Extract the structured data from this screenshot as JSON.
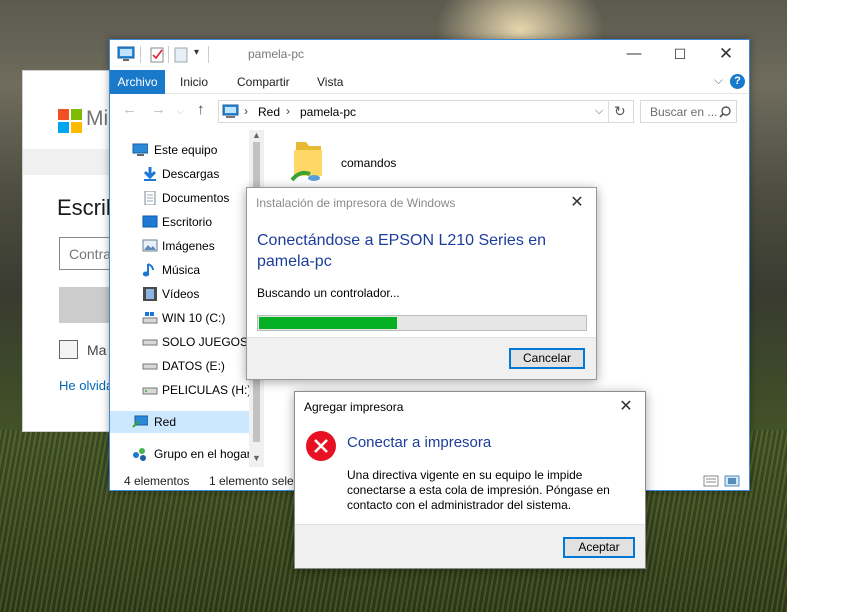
{
  "colors": {
    "accent": "#1979ca",
    "progress": "#06b025",
    "error": "#e81123",
    "selection": "#cce8ff"
  },
  "login": {
    "brand": "Mi",
    "heading": "Escrib",
    "password_placeholder": "Contra",
    "remember_label": "Ma",
    "forgot_link": "He olvida"
  },
  "explorer": {
    "title": "pamela-pc",
    "ribbon_tabs": [
      "Archivo",
      "Inicio",
      "Compartir",
      "Vista"
    ],
    "address": [
      "Red",
      "pamela-pc"
    ],
    "search_placeholder": "Buscar en ...",
    "nav_items": [
      {
        "label": "Este equipo",
        "icon": "this-pc-icon"
      },
      {
        "label": "Descargas",
        "icon": "downloads-icon"
      },
      {
        "label": "Documentos",
        "icon": "documents-icon"
      },
      {
        "label": "Escritorio",
        "icon": "desktop-icon"
      },
      {
        "label": "Imágenes",
        "icon": "pictures-icon"
      },
      {
        "label": "Música",
        "icon": "music-icon"
      },
      {
        "label": "Vídeos",
        "icon": "videos-icon"
      },
      {
        "label": "WIN 10 (C:)",
        "icon": "drive-icon"
      },
      {
        "label": "SOLO JUEGOS (",
        "icon": "drive-icon"
      },
      {
        "label": "DATOS (E:)",
        "icon": "drive-icon"
      },
      {
        "label": "PELICULAS (H:)",
        "icon": "drive-icon"
      },
      {
        "label": "Red",
        "icon": "network-icon"
      },
      {
        "label": "Grupo en el hogar",
        "icon": "homegroup-icon"
      }
    ],
    "content": [
      {
        "label": "comandos",
        "icon": "shared-folder-icon"
      }
    ],
    "status": {
      "count": "4 elementos",
      "selected": "1 elemento selec"
    }
  },
  "printer_install": {
    "title": "Instalación de impresora de Windows",
    "heading": "Conectándose a EPSON L210 Series en pamela-pc",
    "status": "Buscando un controlador...",
    "progress": 0.42,
    "cancel_label": "Cancelar"
  },
  "add_printer": {
    "title": "Agregar impresora",
    "heading": "Conectar a impresora",
    "message": "Una directiva vigente en su equipo le impide conectarse a esta cola de impresión. Póngase en contacto con el administrador del sistema.",
    "accept_label": "Aceptar"
  }
}
